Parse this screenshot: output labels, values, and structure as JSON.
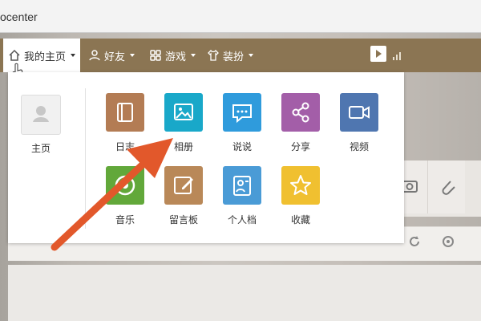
{
  "browser": {
    "url_fragment": "ocenter"
  },
  "nav": {
    "my_home": "我的主页",
    "friends": "好友",
    "games": "游戏",
    "dress_up": "装扮"
  },
  "dropdown": {
    "home_label": "主页",
    "apps": [
      {
        "label": "日志",
        "color": "#b37c54",
        "icon": "notebook-icon"
      },
      {
        "label": "相册",
        "color": "#19a8c9",
        "icon": "image-icon"
      },
      {
        "label": "说说",
        "color": "#2f9bdc",
        "icon": "chat-bubble-icon"
      },
      {
        "label": "分享",
        "color": "#a35ea8",
        "icon": "share-icon"
      },
      {
        "label": "视频",
        "color": "#4f76b0",
        "icon": "video-icon"
      },
      {
        "label": "音乐",
        "color": "#62a83a",
        "icon": "music-icon"
      },
      {
        "label": "留言板",
        "color": "#b98858",
        "icon": "edit-icon"
      },
      {
        "label": "个人档",
        "color": "#4a9bd6",
        "icon": "profile-icon"
      },
      {
        "label": "收藏",
        "color": "#f0c030",
        "icon": "star-icon"
      }
    ]
  },
  "colors": {
    "nav_bg": "#8b7553",
    "arrow": "#e2582b"
  }
}
